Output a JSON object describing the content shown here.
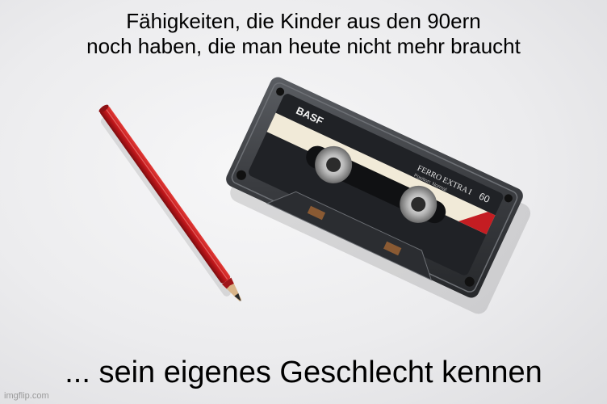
{
  "meme": {
    "top_line_1": "Fähigkeiten, die Kinder aus den 90ern",
    "top_line_2": "noch haben, die man heute nicht mehr braucht",
    "bottom_text": "... sein eigenes Geschlecht kennen",
    "watermark": "imgflip.com"
  },
  "cassette": {
    "brand": "BASF",
    "model": "FERRO EXTRA I",
    "length": "60",
    "position": "Position: Normal"
  },
  "colors": {
    "background": "#ececee",
    "pencil_red": "#c0171b",
    "cassette_body": "#3a3c40",
    "text": "#000000"
  }
}
